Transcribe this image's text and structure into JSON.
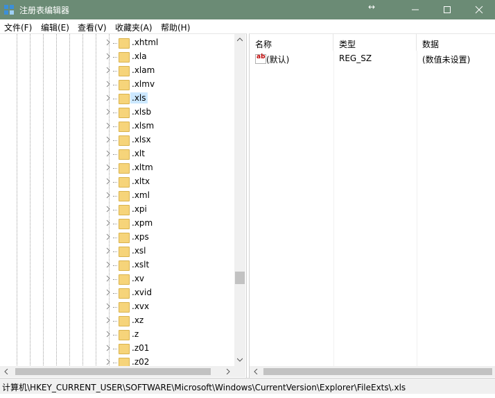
{
  "window": {
    "title": "注册表编辑器",
    "controls": [
      "minimize",
      "maximize",
      "close"
    ]
  },
  "menu": {
    "items": [
      {
        "label": "文件(F)"
      },
      {
        "label": "编辑(E)"
      },
      {
        "label": "查看(V)"
      },
      {
        "label": "收藏夹(A)"
      },
      {
        "label": "帮助(H)"
      }
    ]
  },
  "tree": {
    "selected": ".xls",
    "nodes": [
      {
        "label": ".xhtml"
      },
      {
        "label": ".xla"
      },
      {
        "label": ".xlam"
      },
      {
        "label": ".xlmv"
      },
      {
        "label": ".xls"
      },
      {
        "label": ".xlsb"
      },
      {
        "label": ".xlsm"
      },
      {
        "label": ".xlsx"
      },
      {
        "label": ".xlt"
      },
      {
        "label": ".xltm"
      },
      {
        "label": ".xltx"
      },
      {
        "label": ".xml"
      },
      {
        "label": ".xpi"
      },
      {
        "label": ".xpm"
      },
      {
        "label": ".xps"
      },
      {
        "label": ".xsl"
      },
      {
        "label": ".xslt"
      },
      {
        "label": ".xv"
      },
      {
        "label": ".xvid"
      },
      {
        "label": ".xvx"
      },
      {
        "label": ".xz"
      },
      {
        "label": ".z"
      },
      {
        "label": ".z01"
      },
      {
        "label": ".z02"
      }
    ]
  },
  "values": {
    "columns": [
      "名称",
      "类型",
      "数据"
    ],
    "rows": [
      {
        "icon": "ab",
        "name": "(默认)",
        "type": "REG_SZ",
        "data": "(数值未设置)"
      }
    ]
  },
  "status": {
    "path": "计算机\\HKEY_CURRENT_USER\\SOFTWARE\\Microsoft\\Windows\\CurrentVersion\\Explorer\\FileExts\\.xls"
  },
  "colors": {
    "titlebar": "#6b8b75",
    "selection": "#cce8ff",
    "folder": "#f6d47a"
  }
}
